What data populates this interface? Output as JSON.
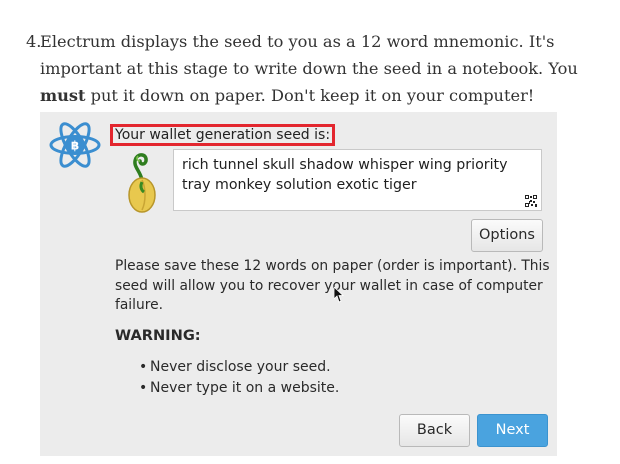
{
  "step": {
    "number": "4.",
    "text_before": "Electrum displays the seed to you as a 12 word mnemonic. It's important at this stage to write down the seed in a notebook. You ",
    "emphasis": "must",
    "text_after": " put it down on paper. Don't keep it on your computer!"
  },
  "dialog": {
    "heading": "Your wallet generation seed is:",
    "seed_words": "rich tunnel skull shadow whisper wing priority tray monkey solution exotic tiger",
    "options_label": "Options",
    "info_text": "Please save these 12 words on paper (order is important). This seed will allow you to recover your wallet in case of computer failure.",
    "warning_title": "WARNING:",
    "warnings": [
      "Never disclose your seed.",
      "Never type it on a website."
    ],
    "back_label": "Back",
    "next_label": "Next",
    "colors": {
      "highlight_border": "#e3262e",
      "next_button": "#4aa3df",
      "dialog_background": "#ececec",
      "logo_blue": "#3b8ed0"
    },
    "icons": [
      "electrum-logo-icon",
      "seed-sprout-icon",
      "qr-code-icon",
      "mouse-cursor-icon"
    ]
  }
}
